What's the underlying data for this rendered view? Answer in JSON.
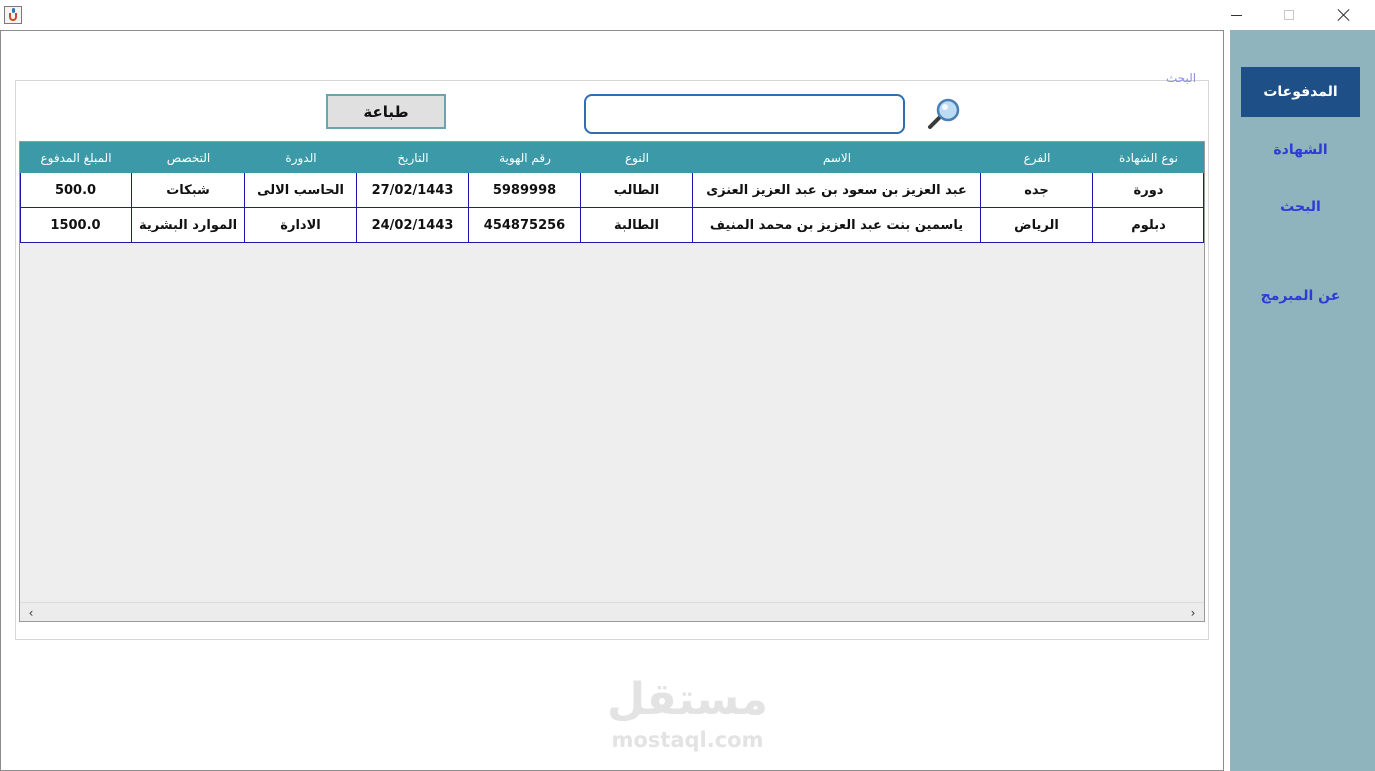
{
  "sidebar": {
    "items": [
      {
        "label": "المدفوعات",
        "active": true
      },
      {
        "label": "الشهادة",
        "active": false
      },
      {
        "label": "البحث",
        "active": false
      },
      {
        "label": "عن المبرمج",
        "active": false
      }
    ]
  },
  "panel": {
    "title": "البحث"
  },
  "toolbar": {
    "print_label": "طباعة",
    "search_value": ""
  },
  "table": {
    "columns": [
      "نوع الشهادة",
      "الفرع",
      "الاسم",
      "النوع",
      "رقم الهوية",
      "التاريخ",
      "الدورة",
      "التخصص",
      "المبلغ المدفوع"
    ],
    "rows": [
      [
        "دورة",
        "جده",
        "عبد العزيز بن سعود بن عبد العزيز العنزى",
        "الطالب",
        "5989998",
        "27/02/1443",
        "الحاسب الالى",
        "شبكات",
        "500.0"
      ],
      [
        "دبلوم",
        "الرياض",
        "ياسمين بنت عبد العزيز بن محمد المنيف",
        "الطالبة",
        "454875256",
        "24/02/1443",
        "الادارة",
        "الموارد البشرية",
        "1500.0"
      ]
    ]
  },
  "watermark": {
    "arabic": "مستقل",
    "latin": "mostaql.com"
  },
  "colors": {
    "sidebar_bg": "#8fb4be",
    "nav_active_bg": "#1e4f86",
    "table_header_bg": "#3c9aa8",
    "nav_text": "#2e3bd6"
  }
}
